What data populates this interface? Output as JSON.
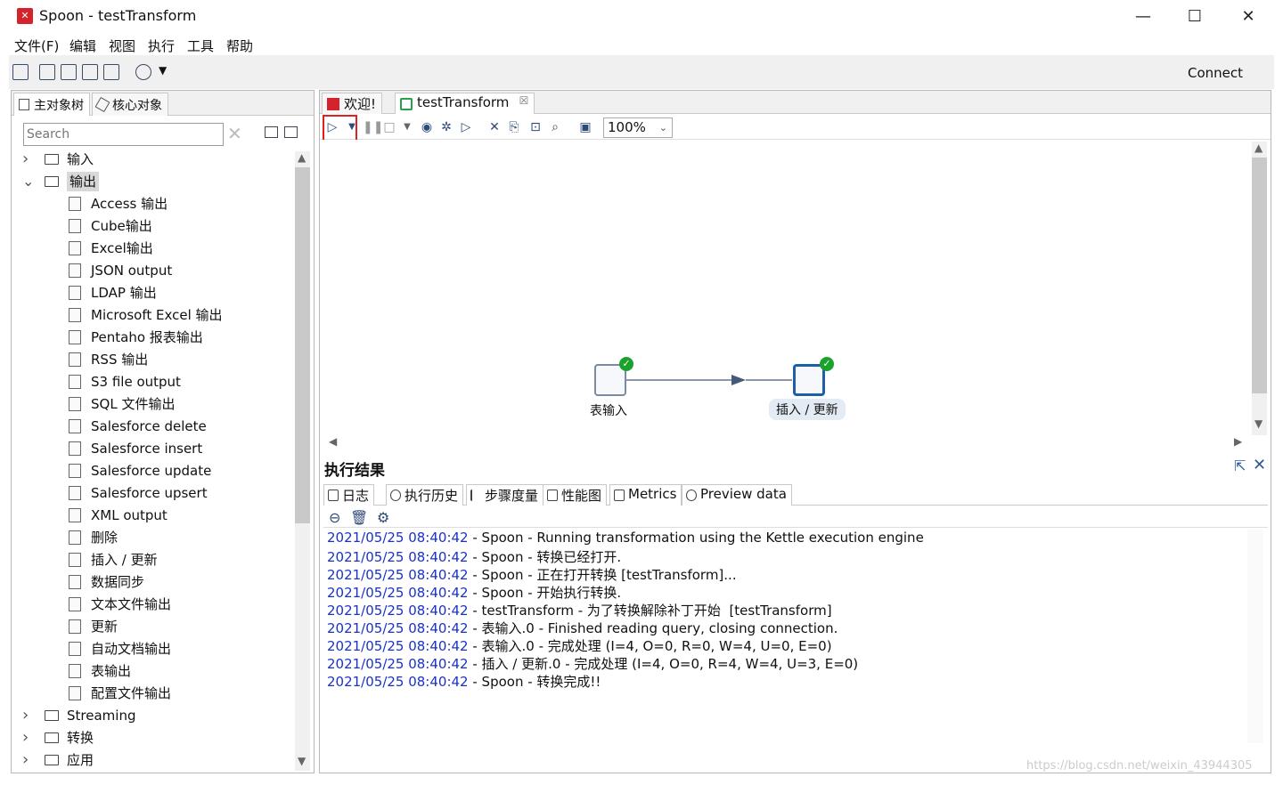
{
  "window": {
    "title": "Spoon - testTransform",
    "minimize": "—",
    "maximize": "☐",
    "close": "✕"
  },
  "menu": [
    "文件(F)",
    "编辑",
    "视图",
    "执行",
    "工具",
    "帮助"
  ],
  "toolbar": {
    "connect_label": "Connect"
  },
  "left_panel": {
    "tabs": [
      {
        "label": "主对象树"
      },
      {
        "label": "核心对象"
      }
    ],
    "search_placeholder": "Search",
    "tree": [
      {
        "label": "输入",
        "type": "folder",
        "expanded": false
      },
      {
        "label": "输出",
        "type": "folder",
        "expanded": true,
        "selected": true
      },
      {
        "label": "Access 输出",
        "type": "step"
      },
      {
        "label": "Cube输出",
        "type": "step"
      },
      {
        "label": "Excel输出",
        "type": "step"
      },
      {
        "label": "JSON output",
        "type": "step"
      },
      {
        "label": "LDAP 输出",
        "type": "step"
      },
      {
        "label": "Microsoft Excel 输出",
        "type": "step"
      },
      {
        "label": "Pentaho 报表输出",
        "type": "step"
      },
      {
        "label": "RSS 输出",
        "type": "step"
      },
      {
        "label": "S3 file output",
        "type": "step"
      },
      {
        "label": "SQL 文件输出",
        "type": "step"
      },
      {
        "label": "Salesforce delete",
        "type": "step"
      },
      {
        "label": "Salesforce insert",
        "type": "step"
      },
      {
        "label": "Salesforce update",
        "type": "step"
      },
      {
        "label": "Salesforce upsert",
        "type": "step"
      },
      {
        "label": "XML output",
        "type": "step"
      },
      {
        "label": "删除",
        "type": "step"
      },
      {
        "label": "插入 / 更新",
        "type": "step"
      },
      {
        "label": "数据同步",
        "type": "step"
      },
      {
        "label": "文本文件输出",
        "type": "step"
      },
      {
        "label": "更新",
        "type": "step"
      },
      {
        "label": "自动文档输出",
        "type": "step"
      },
      {
        "label": "表输出",
        "type": "step"
      },
      {
        "label": "配置文件输出",
        "type": "step"
      },
      {
        "label": "Streaming",
        "type": "folder",
        "expanded": false
      },
      {
        "label": "转换",
        "type": "folder",
        "expanded": false
      },
      {
        "label": "应用",
        "type": "folder",
        "expanded": false
      }
    ]
  },
  "editor": {
    "tabs": [
      {
        "label": "欢迎!"
      },
      {
        "label": "testTransform",
        "close": "☒"
      }
    ],
    "zoom": "100%",
    "nodes": [
      {
        "label": "表输入"
      },
      {
        "label": "插入 / 更新"
      }
    ]
  },
  "results": {
    "title": "执行结果",
    "tabs": [
      {
        "label": "日志"
      },
      {
        "label": "执行历史"
      },
      {
        "label": "步骤度量"
      },
      {
        "label": "性能图"
      },
      {
        "label": "Metrics"
      },
      {
        "label": "Preview data"
      }
    ],
    "log": [
      {
        "ts": "2021/05/25 08:40:42",
        "msg": " - Spoon - Running transformation using the Kettle execution engine"
      },
      {
        "ts": "2021/05/25 08:40:42",
        "msg": " - Spoon - 转换已经打开."
      },
      {
        "ts": "2021/05/25 08:40:42",
        "msg": " - Spoon - 正在打开转换 [testTransform]..."
      },
      {
        "ts": "2021/05/25 08:40:42",
        "msg": " - Spoon - 开始执行转换."
      },
      {
        "ts": "2021/05/25 08:40:42",
        "msg": " - testTransform - 为了转换解除补丁开始  [testTransform]"
      },
      {
        "ts": "2021/05/25 08:40:42",
        "msg": " - 表输入.0 - Finished reading query, closing connection."
      },
      {
        "ts": "2021/05/25 08:40:42",
        "msg": " - 表输入.0 - 完成处理 (I=4, O=0, R=0, W=4, U=0, E=0)"
      },
      {
        "ts": "2021/05/25 08:40:42",
        "msg": " - 插入 / 更新.0 - 完成处理 (I=4, O=0, R=4, W=4, U=3, E=0)"
      },
      {
        "ts": "2021/05/25 08:40:42",
        "msg": " - Spoon - 转换完成!!"
      }
    ]
  },
  "watermark": "https://blog.csdn.net/weixin_43944305"
}
